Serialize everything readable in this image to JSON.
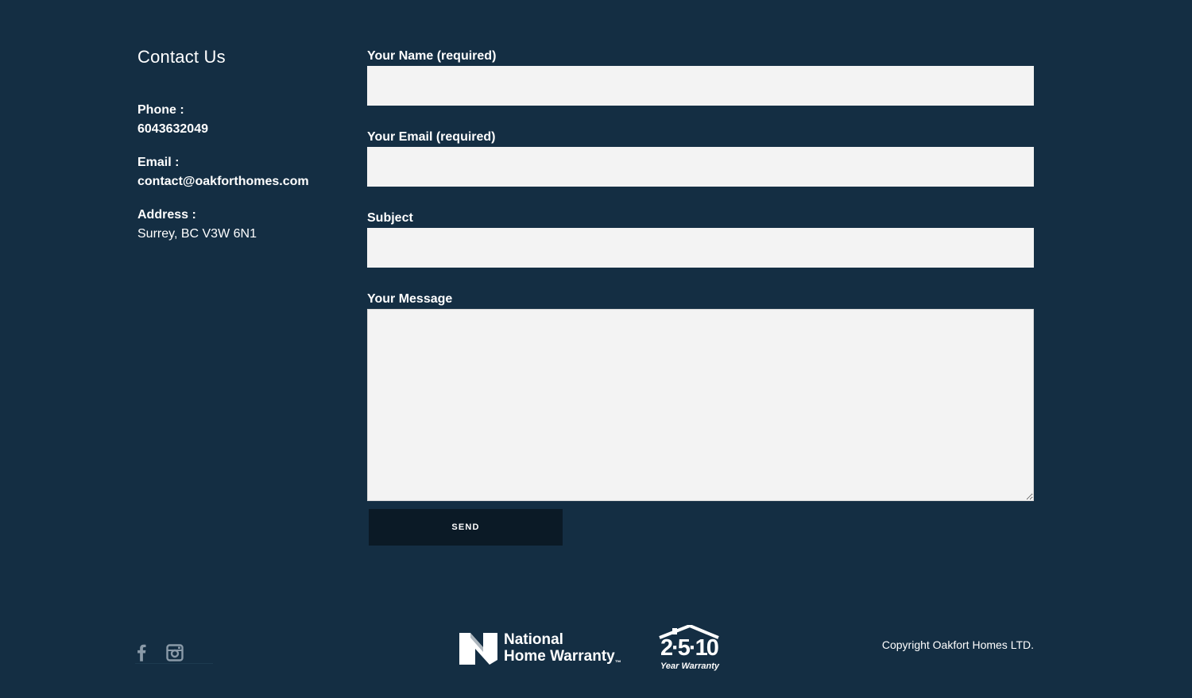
{
  "contact": {
    "title": "Contact Us",
    "phone_label": "Phone :",
    "phone_value": "6043632049",
    "email_label": "Email :",
    "email_value": "contact@oakforthomes.com",
    "address_label": "Address :",
    "address_value": "Surrey, BC V3W 6N1"
  },
  "form": {
    "name_label": "Your Name (required)",
    "name_value": "",
    "email_label": "Your Email (required)",
    "email_value": "",
    "subject_label": "Subject",
    "subject_value": "",
    "message_label": "Your Message",
    "message_value": "",
    "send_label": "SEND"
  },
  "footer": {
    "social_icons": [
      "facebook-icon",
      "instagram-icon"
    ],
    "nhw_line1": "National",
    "nhw_line2": "Home Warranty",
    "nhw_tm": "™",
    "warranty_numbers": "2·5·10",
    "warranty_sub": "Year Warranty",
    "copyright": "Copyright Oakfort Homes LTD."
  },
  "colors": {
    "background": "#142e43",
    "input_background": "#f3f3f3",
    "button_background": "#0b1a26",
    "text": "#ffffff",
    "icon": "#8a9aa8"
  }
}
